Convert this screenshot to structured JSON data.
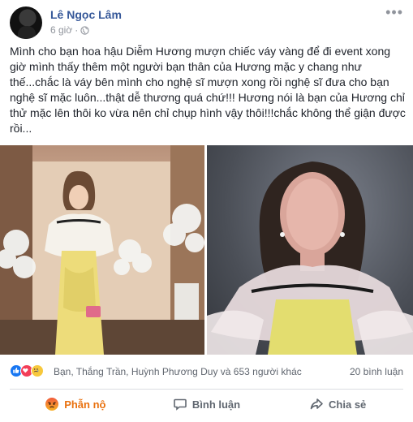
{
  "post": {
    "author": "Lê Ngọc Lâm",
    "timestamp": "6 giờ",
    "privacy_icon": "globe-icon",
    "more_icon": "more-horizontal-icon",
    "more_label": "•••",
    "separator": "·",
    "text": "Mình cho bạn hoa hậu Diễm Hương mượn chiếc váy vàng để đi event xong giờ mình thấy thêm một người bạn thân của Hương mặc y chang như thế...chắc là váy bên mình cho nghệ sĩ mượn xong rồi nghệ sĩ đưa cho bạn nghệ sĩ mặc luôn...thật dễ thương quá chứ!!! Hương nói là bạn của Hương chỉ thử mặc lên thôi ko vừa nên chỉ chụp hình vậy thôi!!!chắc không thể giận được rồi..."
  },
  "reactions": {
    "icons": [
      "like-reaction-icon",
      "love-reaction-icon",
      "sad-reaction-icon"
    ],
    "summary": "Bạn, Thắng Trần, Huỳnh Phương Duy và 653 người khác",
    "comments": "20 bình luận"
  },
  "actions": {
    "react_label": "Phẫn nộ",
    "comment_label": "Bình luận",
    "share_label": "Chia sẻ"
  },
  "colors": {
    "author": "#365899",
    "angry_active": "#e9710f",
    "like_blue": "#1877f2",
    "love_red": "#f33e58"
  }
}
